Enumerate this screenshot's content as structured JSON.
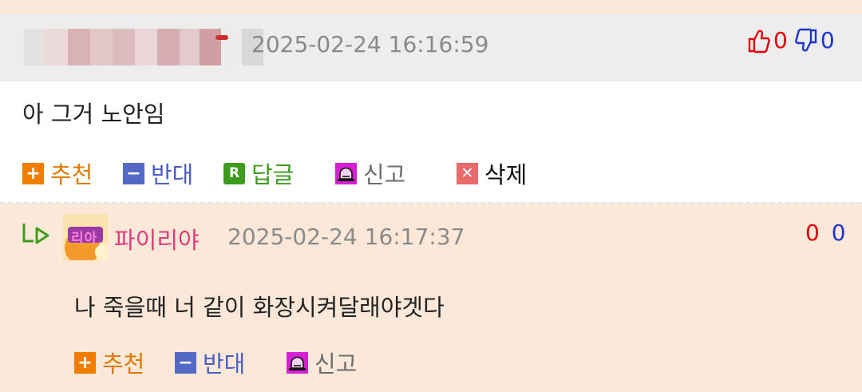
{
  "comment1": {
    "timestamp": "2025-02-24 16:16:59",
    "upvotes": "0",
    "downvotes": "0",
    "text": "아 그거 노안임",
    "actions": {
      "recommend": "추천",
      "oppose": "반대",
      "reply": "답글",
      "report": "신고",
      "delete": "삭제"
    }
  },
  "comment2": {
    "nickname": "파이리야",
    "avatar_text": "리아",
    "timestamp": "2025-02-24 16:17:37",
    "upvotes": "0",
    "downvotes": "0",
    "text": "나 죽을때 너 같이 화장시켜달래야겟다",
    "actions": {
      "recommend": "추천",
      "oppose": "반대",
      "report": "신고"
    }
  },
  "colors": {
    "background": "#fbe8d9",
    "header_gray": "#ededed",
    "upvote_red": "#e1000b",
    "downvote_blue": "#1f35c9",
    "recommend_orange": "#ef7d00",
    "oppose_blue": "#5468c5",
    "reply_green": "#3d9c1e",
    "report_magenta": "#d51fd2",
    "delete_red": "#e96a6a",
    "nickname_pink": "#e03a7a"
  },
  "icons": {
    "upvote": "thumbs-up-icon",
    "downvote": "thumbs-down-icon",
    "reply_arrow": "reply-arrow-icon",
    "report": "siren-icon"
  }
}
